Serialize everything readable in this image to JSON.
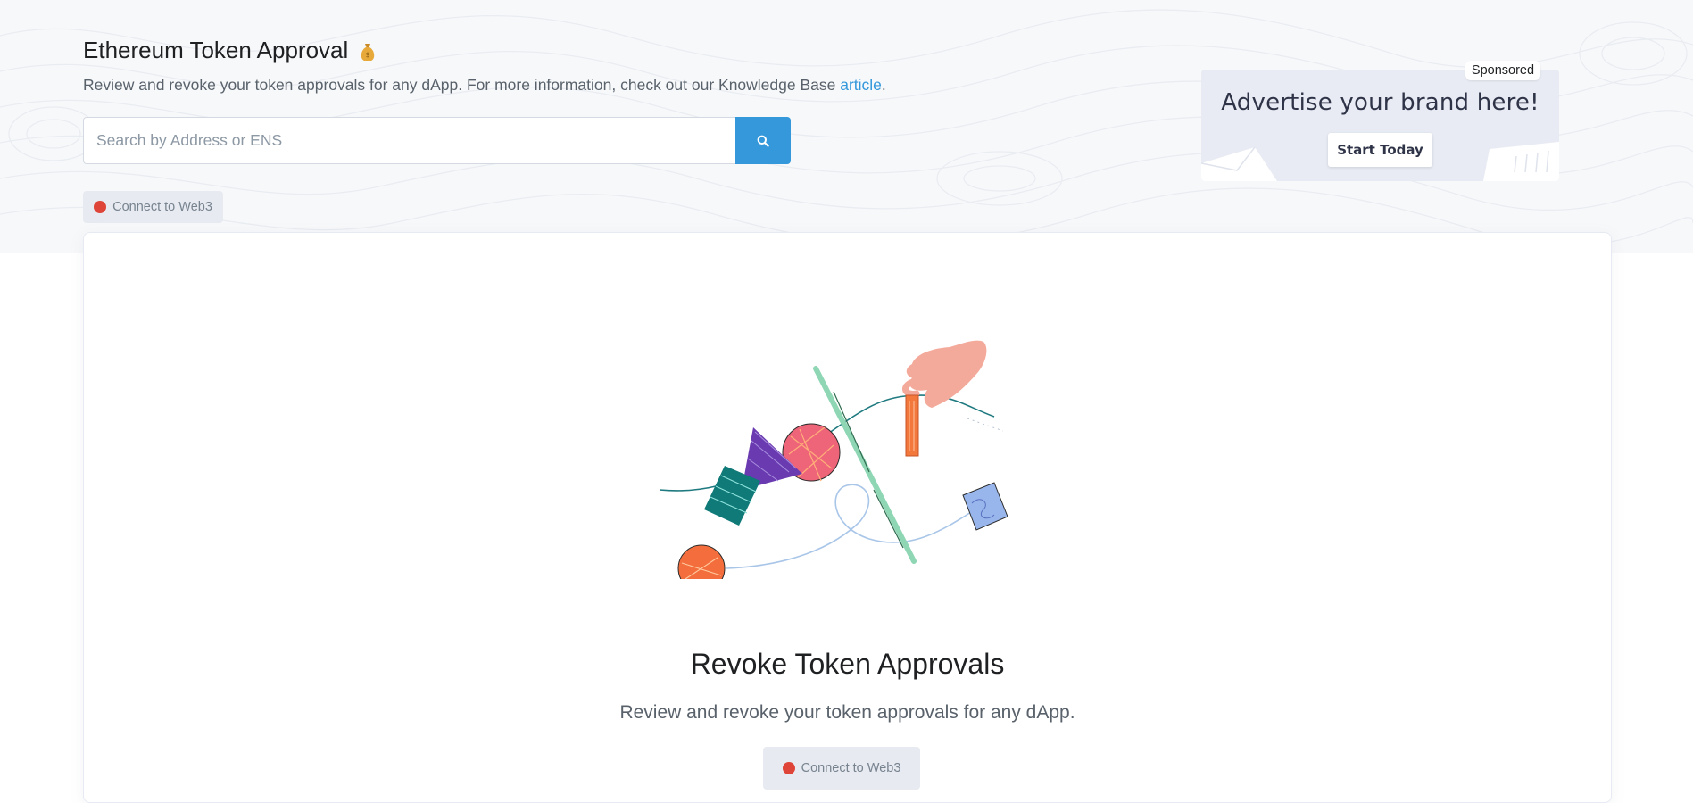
{
  "header": {
    "title": "Ethereum Token Approval",
    "title_icon": "money-bag-icon",
    "description_prefix": "Review and revoke your token approvals for any dApp. For more information, check out our Knowledge Base ",
    "description_link": "article",
    "description_suffix": "."
  },
  "search": {
    "placeholder": "Search by Address or ENS",
    "value": "",
    "button_icon": "search-icon"
  },
  "connect_top": {
    "label": "Connect to Web3",
    "status_color": "#de4437"
  },
  "ad": {
    "badge": "Sponsored",
    "headline": "Advertise your brand here!",
    "cta": "Start Today"
  },
  "main": {
    "title": "Revoke Token Approvals",
    "subtitle": "Review and revoke your token approvals for any dApp.",
    "connect_label": "Connect to Web3"
  },
  "colors": {
    "accent": "#3498db",
    "disconnected": "#de4437",
    "muted_button": "#e7eaf0"
  }
}
